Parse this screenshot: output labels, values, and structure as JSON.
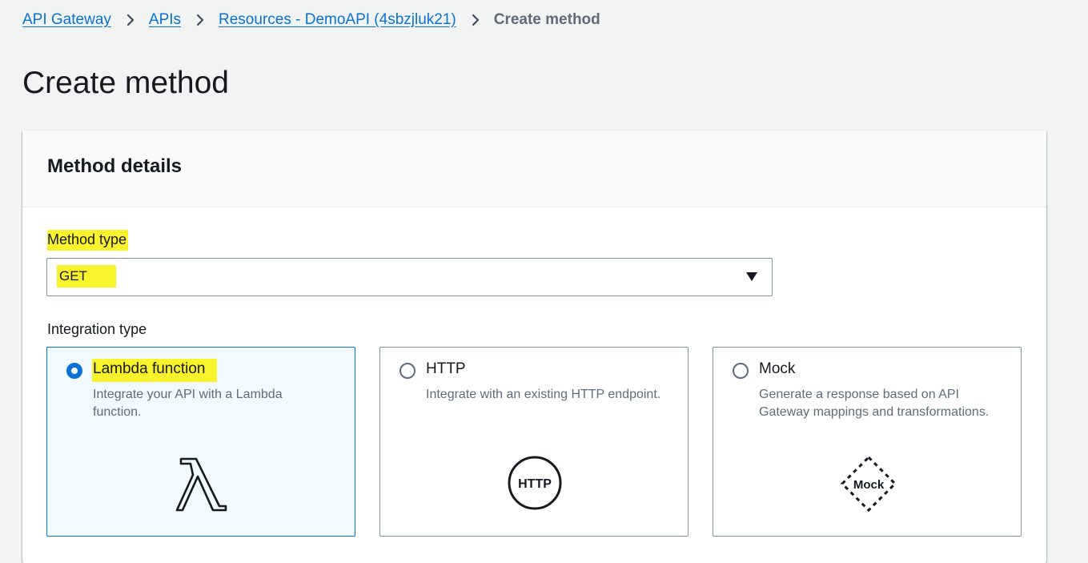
{
  "breadcrumb": {
    "items": [
      "API Gateway",
      "APIs",
      "Resources - DemoAPI (4sbzjluk21)"
    ],
    "current": "Create method"
  },
  "page": {
    "title": "Create method"
  },
  "panel": {
    "title": "Method details",
    "method_type": {
      "label": "Method type",
      "value": "GET"
    },
    "integration_type": {
      "label": "Integration type",
      "options": [
        {
          "title": "Lambda function",
          "description": "Integrate your API with a Lambda function.",
          "icon": "lambda-icon",
          "selected": true
        },
        {
          "title": "HTTP",
          "description": "Integrate with an existing HTTP endpoint.",
          "icon": "http-icon",
          "icon_text": "HTTP",
          "selected": false
        },
        {
          "title": "Mock",
          "description": "Generate a response based on API Gateway mappings and transformations.",
          "icon": "mock-icon",
          "icon_text": "Mock",
          "selected": false
        }
      ]
    }
  },
  "colors": {
    "link": "#0972d3",
    "highlight": "#f8f32b",
    "selected_bg": "#f1faff"
  }
}
